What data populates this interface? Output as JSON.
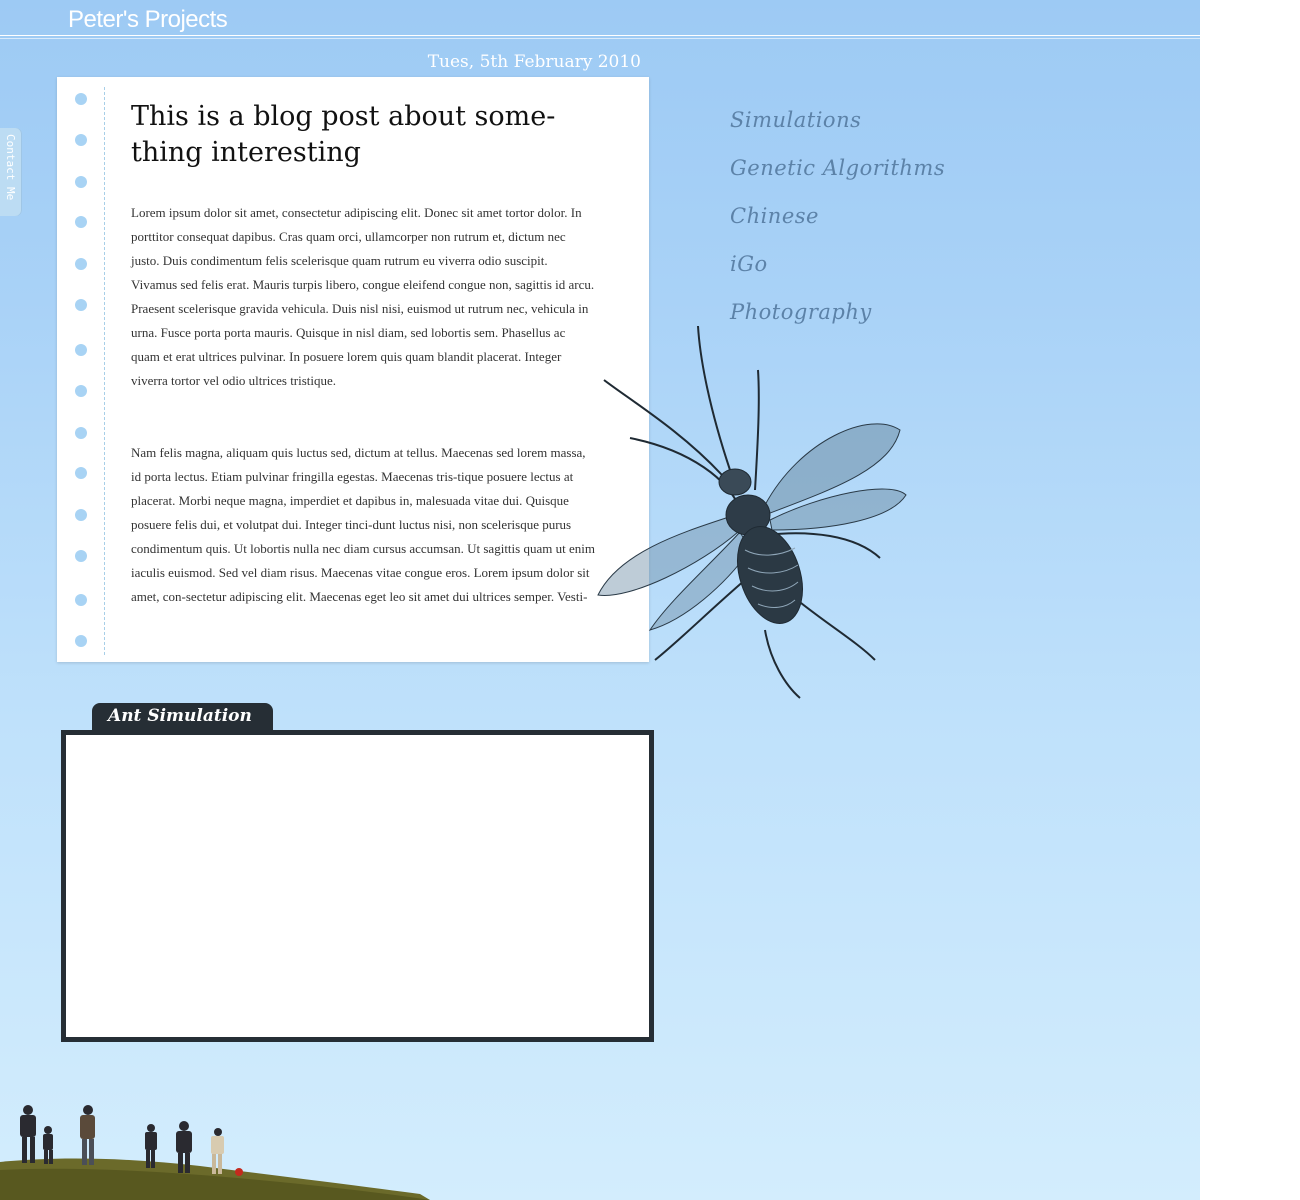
{
  "site": {
    "title": "Peter's Projects"
  },
  "post": {
    "date": "Tues, 5th February 2010",
    "title": "This is a blog post about some-thing interesting",
    "paragraphs": [
      "Lorem ipsum dolor sit amet, consectetur adipiscing elit. Donec sit amet tortor dolor. In porttitor consequat dapibus. Cras quam orci, ullamcorper non rutrum et, dictum nec justo. Duis condimentum felis scelerisque quam rutrum eu viverra odio suscipit. Vivamus sed felis erat. Mauris turpis libero, congue eleifend congue non, sagittis id arcu. Praesent scelerisque gravida vehicula. Duis nisl nisi, euismod ut rutrum nec, vehicula in urna. Fusce porta porta mauris. Quisque in nisl diam, sed lobortis sem. Phasellus ac quam et erat ultrices pulvinar. In posuere lorem quis quam blandit placerat. Integer viverra tortor vel odio ultrices tristique.",
      "Nam felis magna, aliquam quis luctus sed, dictum at tellus. Maecenas sed lorem massa, id porta lectus. Etiam pulvinar fringilla egestas. Maecenas tris-tique posuere lectus at placerat. Morbi neque magna, imperdiet et dapibus in, malesuada vitae dui. Quisque posuere felis dui, et volutpat dui. Integer tinci-dunt luctus nisi, non scelerisque purus condimentum quis. Ut lobortis nulla nec diam cursus accumsan. Ut sagittis quam ut enim iaculis euismod. Sed vel diam risus. Maecenas vitae congue eros. Lorem ipsum dolor sit amet, con-sectetur adipiscing elit. Maecenas eget leo sit amet dui ultrices semper. Vesti-"
    ]
  },
  "nav": {
    "items": [
      "Simulations",
      "Genetic Algorithms",
      "Chinese",
      "iGo",
      "Photography"
    ]
  },
  "contact_tab": {
    "label": "Contact Me"
  },
  "simulation": {
    "title": "Ant Simulation"
  },
  "icons": {
    "decoration": "beetle-illustration-icon"
  },
  "colors": {
    "sky": "#a9d2f7",
    "accent_dark": "#262e35",
    "nav_text": "#5c82a8"
  }
}
